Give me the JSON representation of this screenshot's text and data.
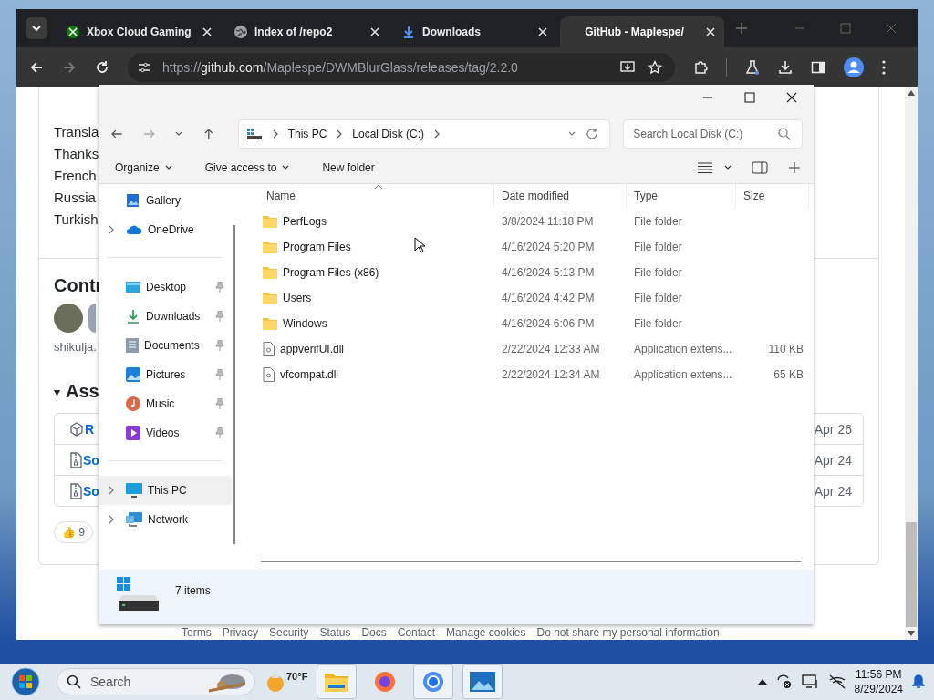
{
  "browser": {
    "tabs": [
      {
        "title": "Xbox Cloud Gaming",
        "kind": "xbox",
        "selected": false
      },
      {
        "title": "Index of /repo2",
        "kind": "globe",
        "selected": false
      },
      {
        "title": "Downloads",
        "kind": "download",
        "selected": false
      },
      {
        "title": "GitHub - Maplespe/",
        "kind": "plain",
        "selected": true
      }
    ],
    "url_scheme": "https://",
    "url_host": "github.com",
    "url_path": "/Maplespe/DWMBlurGlass/releases/tag/2.2.0"
  },
  "page": {
    "lines": [
      "Transla",
      "Thanks",
      "French",
      "Russia",
      "Turkish"
    ],
    "contributors_heading": "Contr",
    "contributors_caption": "shikulja.",
    "assets_toggle": "▾",
    "assets_heading": "Ass",
    "assets": [
      {
        "name": "R",
        "kind": "package",
        "date": "Apr 26"
      },
      {
        "name": "So",
        "kind": "zip",
        "date": "Apr 24"
      },
      {
        "name": "So",
        "kind": "zip",
        "date": "Apr 24"
      }
    ],
    "reaction": {
      "emoji": "👍",
      "count": "9"
    },
    "footer_links": [
      "Terms",
      "Privacy",
      "Security",
      "Status",
      "Docs",
      "Contact",
      "Manage cookies",
      "Do not share my personal information"
    ]
  },
  "explorer": {
    "breadcrumb": [
      "This PC",
      "Local Disk (C:)"
    ],
    "search": {
      "placeholder": "Search Local Disk (C:)"
    },
    "commands": [
      {
        "label": "Organize",
        "dropdown": true
      },
      {
        "label": "Give access to",
        "dropdown": true
      },
      {
        "label": "New folder",
        "dropdown": false
      }
    ],
    "sidebar": [
      [
        {
          "label": "Gallery",
          "kind": "gallery",
          "expandable": false,
          "pinned": false,
          "selected": false
        },
        {
          "label": "OneDrive",
          "kind": "cloud",
          "expandable": true,
          "pinned": false,
          "selected": false
        }
      ],
      [
        {
          "label": "Desktop",
          "kind": "desktop",
          "expandable": false,
          "pinned": true,
          "selected": false
        },
        {
          "label": "Downloads",
          "kind": "download",
          "expandable": false,
          "pinned": true,
          "selected": false
        },
        {
          "label": "Documents",
          "kind": "documents",
          "expandable": false,
          "pinned": true,
          "selected": false
        },
        {
          "label": "Pictures",
          "kind": "pictures",
          "expandable": false,
          "pinned": true,
          "selected": false
        },
        {
          "label": "Music",
          "kind": "music",
          "expandable": false,
          "pinned": true,
          "selected": false
        },
        {
          "label": "Videos",
          "kind": "videos",
          "expandable": false,
          "pinned": true,
          "selected": false
        }
      ],
      [
        {
          "label": "This PC",
          "kind": "pc",
          "expandable": true,
          "pinned": false,
          "selected": true
        },
        {
          "label": "Network",
          "kind": "network",
          "expandable": true,
          "pinned": false,
          "selected": false
        }
      ]
    ],
    "columns": [
      "Name",
      "Date modified",
      "Type",
      "Size"
    ],
    "files": [
      {
        "name": "PerfLogs",
        "kind": "folder",
        "date": "3/8/2024 11:18 PM",
        "type": "File folder"
      },
      {
        "name": "Program Files",
        "kind": "folder",
        "date": "4/16/2024 5:20 PM",
        "type": "File folder"
      },
      {
        "name": "Program Files (x86)",
        "kind": "folder",
        "date": "4/16/2024 5:13 PM",
        "type": "File folder"
      },
      {
        "name": "Users",
        "kind": "folder",
        "date": "4/16/2024 4:42 PM",
        "type": "File folder"
      },
      {
        "name": "Windows",
        "kind": "folder",
        "date": "4/16/2024 6:06 PM",
        "type": "File folder"
      },
      {
        "name": "appverifUI.dll",
        "kind": "file",
        "date": "2/22/2024 12:33 AM",
        "type": "Application extens...",
        "size": "110 KB"
      },
      {
        "name": "vfcompat.dll",
        "kind": "file",
        "date": "2/22/2024 12:34 AM",
        "type": "Application extens...",
        "size": "65 KB"
      }
    ],
    "status": "7 items"
  },
  "taskbar": {
    "search_placeholder": "Search",
    "weather": "70°F",
    "time": "11:56 PM",
    "date": "8/29/2024"
  }
}
